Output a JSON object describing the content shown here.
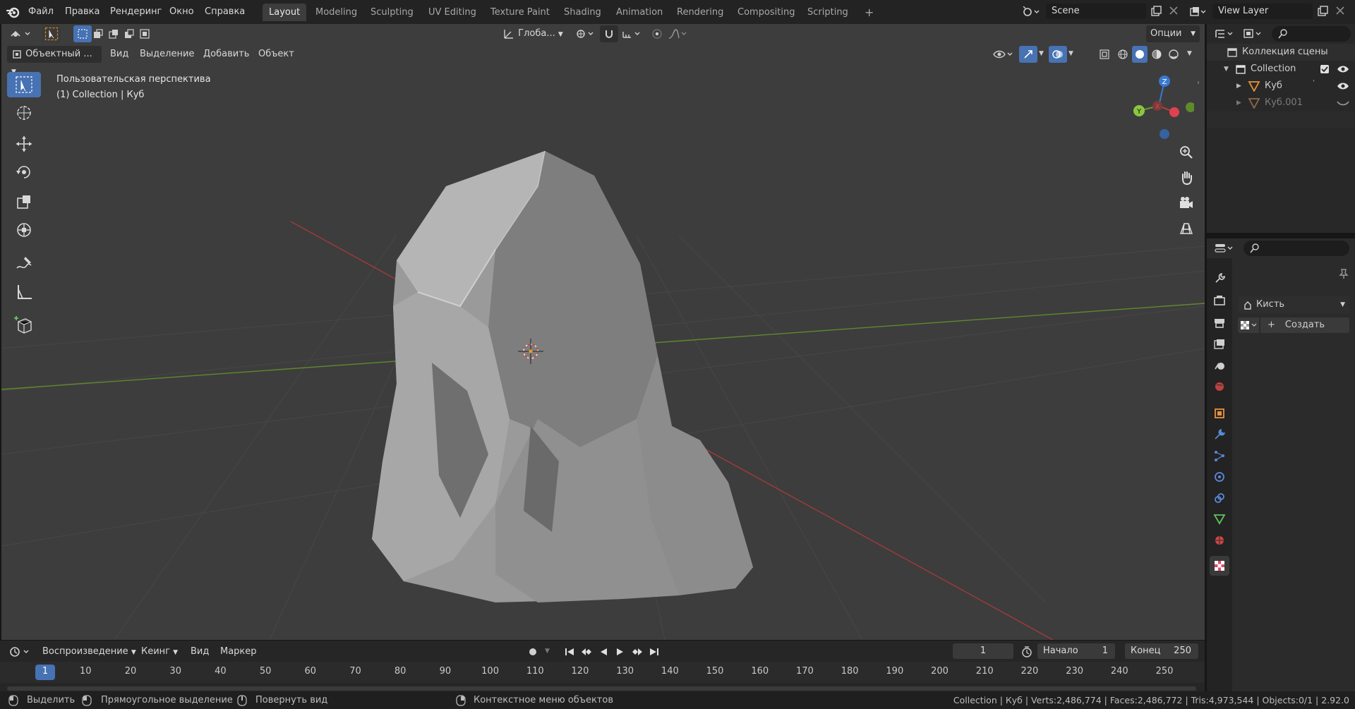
{
  "topbar": {
    "menus": [
      "Файл",
      "Правка",
      "Рендеринг",
      "Окно",
      "Справка"
    ],
    "workspace_tabs": [
      "Layout",
      "Modeling",
      "Sculpting",
      "UV Editing",
      "Texture Paint",
      "Shading",
      "Animation",
      "Rendering",
      "Compositing",
      "Scripting"
    ],
    "active_tab": "Layout",
    "add_tab": "+",
    "scene_name": "Scene",
    "view_layer": "View Layer"
  },
  "viewport": {
    "transform_orientation": "Глоба...",
    "options_label": "Опции",
    "mode": "Объектный ...",
    "header_menus": [
      "Вид",
      "Выделение",
      "Добавить",
      "Объект"
    ],
    "info_line1": "Пользовательская перспектива",
    "info_line2": "(1) Collection | Куб",
    "gizmo": {
      "x": "X",
      "y": "Y",
      "z": "Z"
    }
  },
  "timeline": {
    "menus": [
      "Воспроизведение",
      "Кеинг",
      "Вид",
      "Маркер"
    ],
    "current_frame": "1",
    "start_label": "Начало",
    "start_value": "1",
    "end_label": "Конец",
    "end_value": "250",
    "ruler": [
      "1",
      "10",
      "20",
      "30",
      "40",
      "50",
      "60",
      "70",
      "80",
      "90",
      "100",
      "110",
      "120",
      "130",
      "140",
      "150",
      "160",
      "170",
      "180",
      "190",
      "200",
      "210",
      "220",
      "230",
      "240",
      "250"
    ]
  },
  "statusbar": {
    "select": "Выделить",
    "box_select": "Прямоугольное выделение",
    "rotate_view": "Повернуть вид",
    "context_menu": "Контекстное меню объектов",
    "stats": "Collection | Куб | Verts:2,486,774 | Faces:2,486,772 | Tris:4,973,544 | Objects:0/1 | 2.92.0"
  },
  "outliner": {
    "root": "Коллекция сцены",
    "collection": "Collection",
    "items": [
      "Куб",
      "Куб.001"
    ]
  },
  "properties": {
    "brush_label": "Кисть",
    "new_button": "Создать"
  },
  "colors": {
    "accent": "#4772b3",
    "x_axis": "#c03a3a",
    "y_axis": "#6a9a2a",
    "z_axis": "#3a78d4",
    "header_bg": "#232323",
    "viewport_bg": "#3d3d3d"
  }
}
